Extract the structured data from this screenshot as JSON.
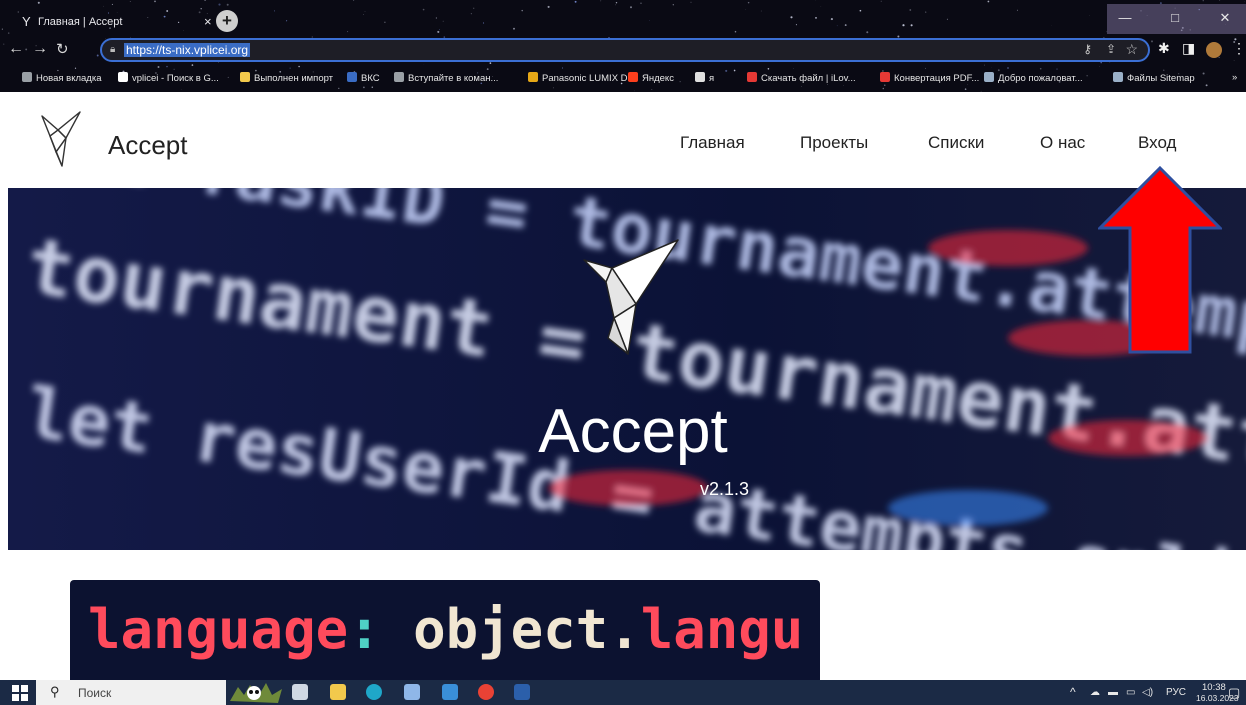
{
  "browser": {
    "tab_title": "Главная | Accept",
    "tab_close_glyph": "×",
    "new_tab_glyph": "+",
    "url": "https://ts-nix.vplicei.org",
    "window_controls": [
      "—",
      "□",
      "✕"
    ],
    "bookmarks": [
      {
        "label": "Новая вкладка",
        "icon": "globe-icon",
        "color": "#9aa0a6"
      },
      {
        "label": "vplicei - Поиск в G...",
        "icon": "google-icon",
        "color": "#ffffff"
      },
      {
        "label": "Выполнен импорт",
        "icon": "folder-icon",
        "color": "#f2c94c"
      },
      {
        "label": "ВКС",
        "icon": "vks-icon",
        "color": "#3a6cc4"
      },
      {
        "label": "Вступайте в коман...",
        "icon": "globe-icon",
        "color": "#9aa0a6"
      },
      {
        "label": "Panasonic LUMIX D...",
        "icon": "panasonic-icon",
        "color": "#e6a817"
      },
      {
        "label": "Яндекс",
        "icon": "yandex-icon",
        "color": "#fc3f1d"
      },
      {
        "label": "я",
        "icon": "folder-icon",
        "color": "#e0e0e0"
      },
      {
        "label": "Скачать файл | iLov...",
        "icon": "heart-icon",
        "color": "#e53935"
      },
      {
        "label": "Конвертация PDF...",
        "icon": "heart-icon",
        "color": "#e53935"
      },
      {
        "label": "Добро пожаловат...",
        "icon": "server-icon",
        "color": "#9ab0c8"
      },
      {
        "label": "Файлы Sitemap",
        "icon": "server-icon",
        "color": "#9ab0c8"
      }
    ],
    "bookmarks_more": "»"
  },
  "site": {
    "name": "Accept",
    "nav": [
      "Главная",
      "Проекты",
      "Списки",
      "О нас",
      "Вход"
    ]
  },
  "hero": {
    "title": "Accept",
    "version": "v2.1.3",
    "code_lines": [
      {
        "text": "let TaskID = tournament.attempts[id",
        "color": "#c9d6ff"
      },
      {
        "text": "tournament = tournament.attempts[id",
        "color": "#e6ecff"
      },
      {
        "text": "let resUserId = attempts.splice(idx,",
        "color": "#dfe6ff"
      }
    ]
  },
  "card": {
    "code": [
      {
        "text": "language",
        "color": "#ff4b5c"
      },
      {
        "text": ": ",
        "color": "#4fd1c5"
      },
      {
        "text": "object",
        "color": "#f1e6d2"
      },
      {
        "text": ".",
        "color": "#f1e6d2"
      },
      {
        "text": "langu",
        "color": "#ff4b5c"
      }
    ]
  },
  "annotation": {
    "arrow_color": "#ff0000",
    "arrow_border": "#2f4f9f"
  },
  "taskbar": {
    "search_label": "Поиск",
    "apps": [
      {
        "name": "task-view-icon",
        "color": "#cfd8e3"
      },
      {
        "name": "file-explorer-icon",
        "color": "#f2c94c"
      },
      {
        "name": "edge-icon",
        "color": "#1fa7c9"
      },
      {
        "name": "store-icon",
        "color": "#8fb7e8"
      },
      {
        "name": "mail-icon",
        "color": "#3a8fd8"
      },
      {
        "name": "chrome-icon",
        "color": "#e94235"
      },
      {
        "name": "word-icon",
        "color": "#2b5faa"
      }
    ],
    "tray": {
      "lang": "РУС",
      "time": "10:38",
      "date": "16.03.2023"
    }
  }
}
